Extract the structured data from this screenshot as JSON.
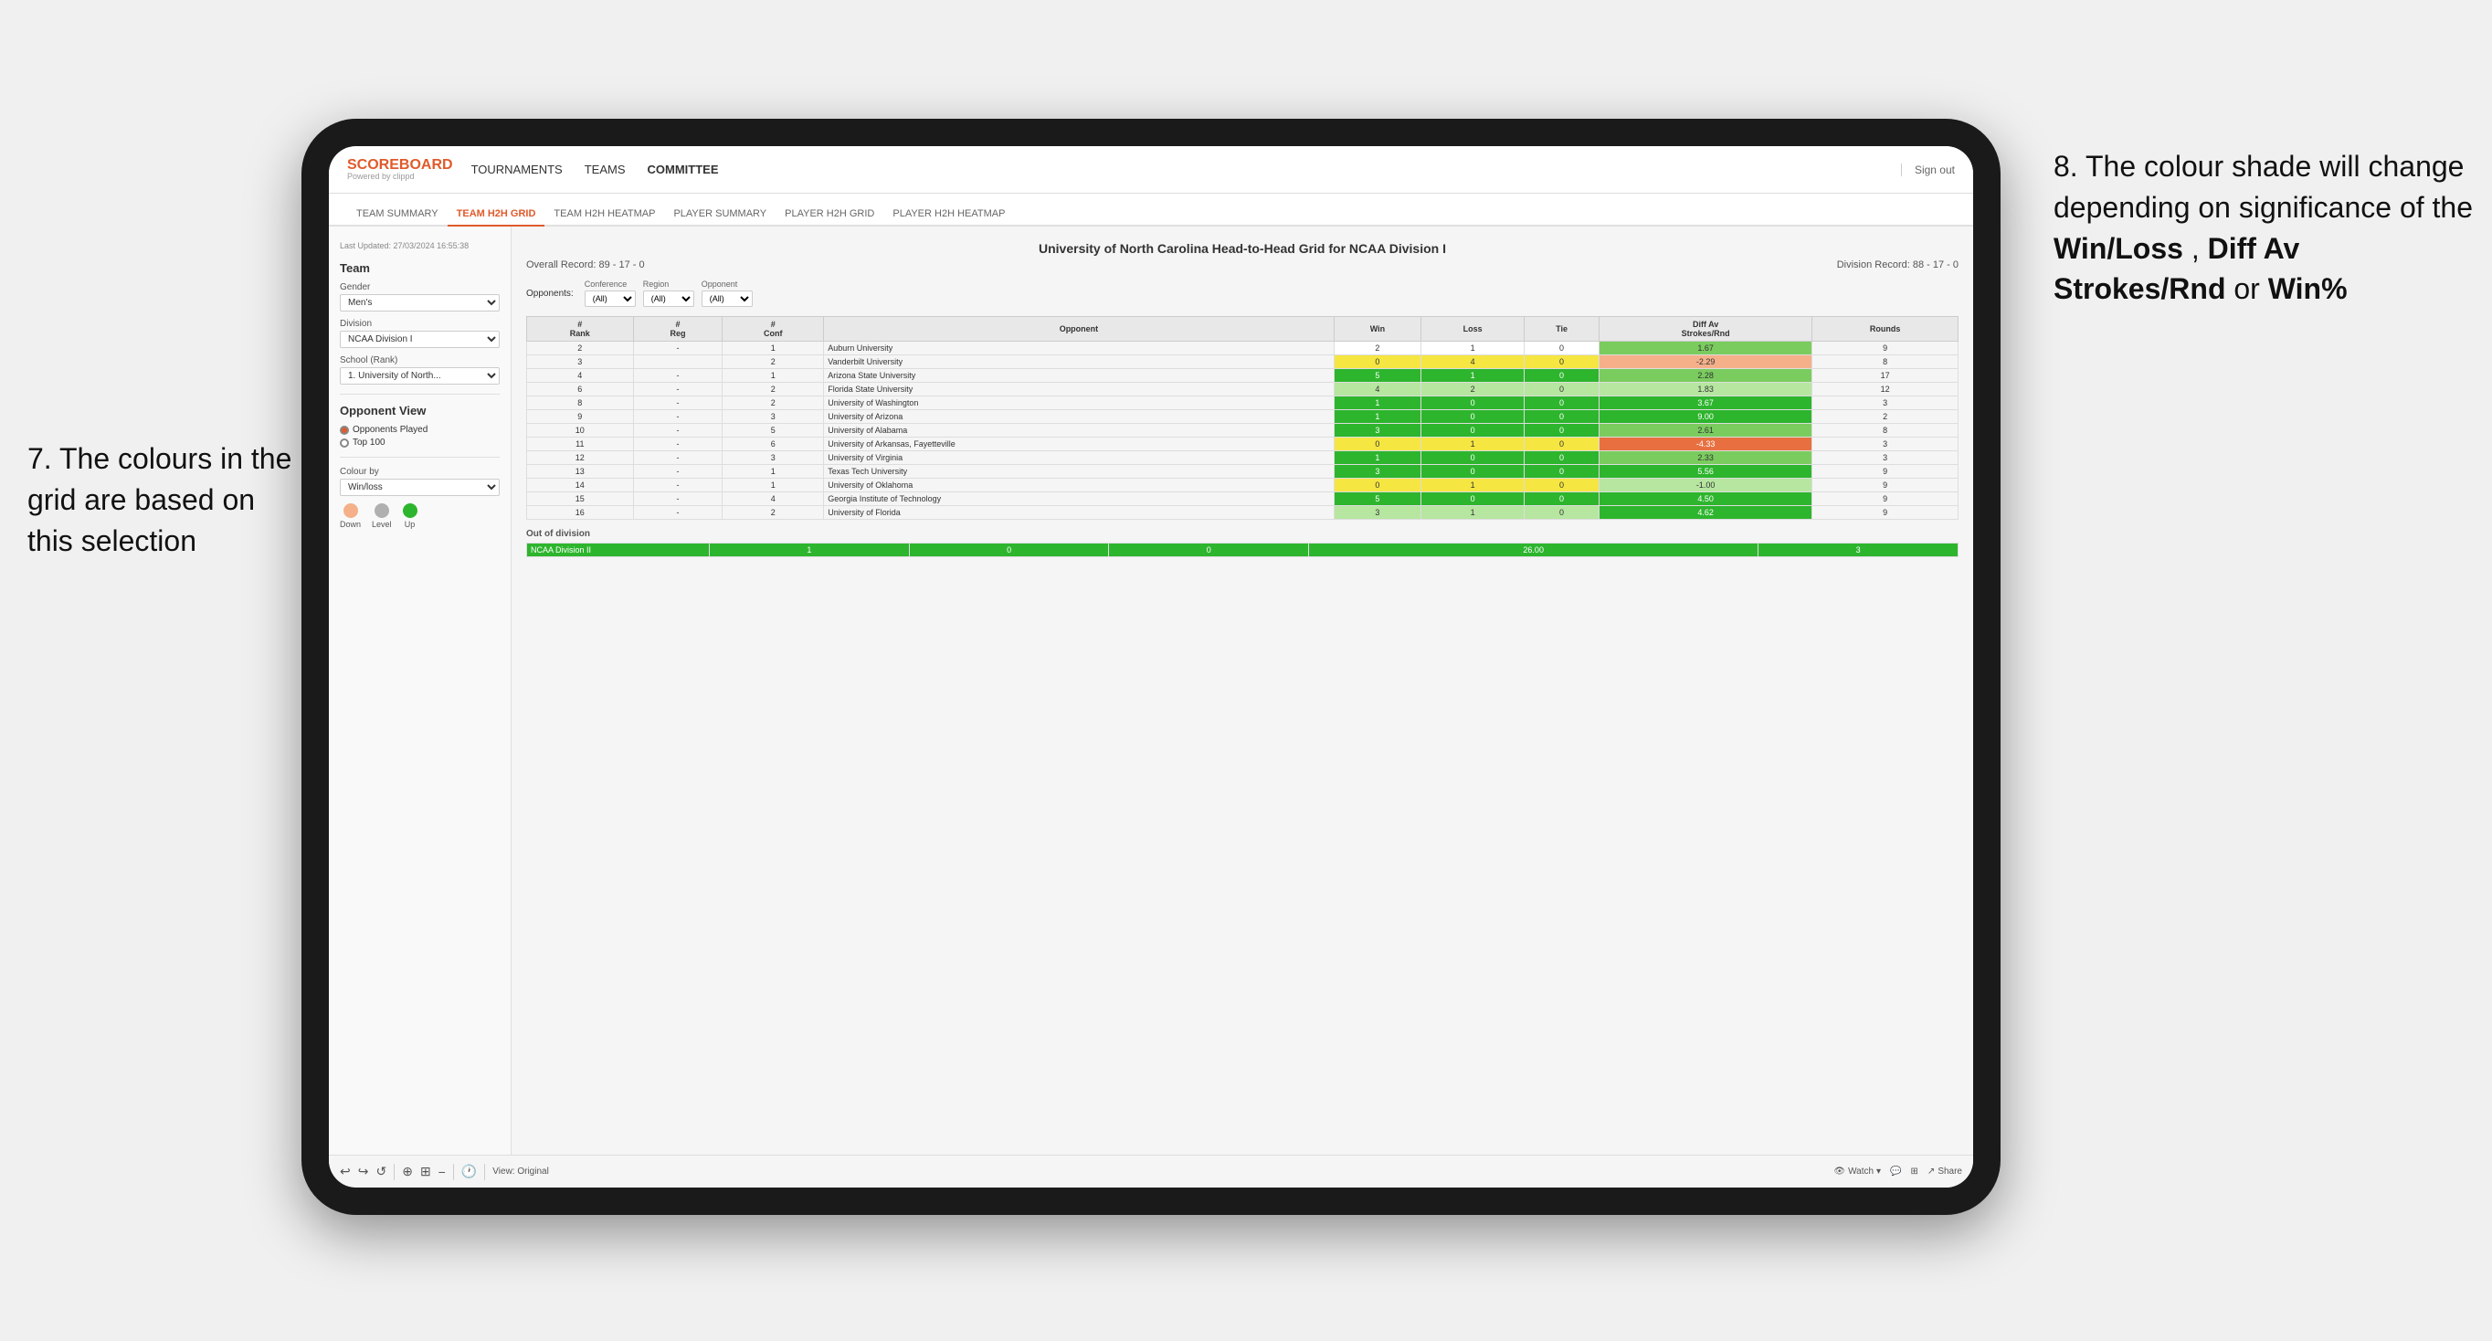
{
  "annotations": {
    "left_title": "7. The colours in the grid are based on this selection",
    "right_title": "8. The colour shade will change depending on significance of the",
    "right_bold1": "Win/Loss",
    "right_bold2": "Diff Av Strokes/Rnd",
    "right_bold3": "Win%",
    "right_connector": " or "
  },
  "nav": {
    "logo": "SCOREBOARD",
    "logo_sub": "Powered by clippd",
    "links": [
      "TOURNAMENTS",
      "TEAMS",
      "COMMITTEE"
    ],
    "active_link": "COMMITTEE",
    "sign_out": "Sign out"
  },
  "sub_nav": {
    "items": [
      "TEAM SUMMARY",
      "TEAM H2H GRID",
      "TEAM H2H HEATMAP",
      "PLAYER SUMMARY",
      "PLAYER H2H GRID",
      "PLAYER H2H HEATMAP"
    ],
    "active": "TEAM H2H GRID"
  },
  "sidebar": {
    "timestamp": "Last Updated: 27/03/2024\n16:55:38",
    "section_title": "Team",
    "gender_label": "Gender",
    "gender_value": "Men's",
    "division_label": "Division",
    "division_value": "NCAA Division I",
    "school_label": "School (Rank)",
    "school_value": "1. University of North...",
    "opponent_view_label": "Opponent View",
    "radio_opponents": "Opponents Played",
    "radio_top100": "Top 100",
    "colour_by_label": "Colour by",
    "colour_by_value": "Win/loss",
    "legend_down": "Down",
    "legend_level": "Level",
    "legend_up": "Up"
  },
  "grid": {
    "title": "University of North Carolina Head-to-Head Grid for NCAA Division I",
    "overall_record": "Overall Record: 89 - 17 - 0",
    "division_record": "Division Record: 88 - 17 - 0",
    "filters": {
      "opponents_label": "Opponents:",
      "conference_label": "Conference",
      "conference_value": "(All)",
      "region_label": "Region",
      "region_value": "(All)",
      "opponent_label": "Opponent",
      "opponent_value": "(All)"
    },
    "columns": [
      "#\nRank",
      "#\nReg",
      "#\nConf",
      "Opponent",
      "Win",
      "Loss",
      "Tie",
      "Diff Av\nStrokes/Rnd",
      "Rounds"
    ],
    "rows": [
      {
        "rank": "2",
        "reg": "-",
        "conf": "1",
        "opponent": "Auburn University",
        "win": "2",
        "loss": "1",
        "tie": "0",
        "diff": "1.67",
        "rounds": "9",
        "win_color": "white",
        "diff_color": "green_mid"
      },
      {
        "rank": "3",
        "reg": "",
        "conf": "2",
        "opponent": "Vanderbilt University",
        "win": "0",
        "loss": "4",
        "tie": "0",
        "diff": "-2.29",
        "rounds": "8",
        "win_color": "yellow",
        "diff_color": "red_light"
      },
      {
        "rank": "4",
        "reg": "-",
        "conf": "1",
        "opponent": "Arizona State University",
        "win": "5",
        "loss": "1",
        "tie": "0",
        "diff": "2.28",
        "rounds": "17",
        "win_color": "green_strong",
        "diff_color": "green_mid"
      },
      {
        "rank": "6",
        "reg": "-",
        "conf": "2",
        "opponent": "Florida State University",
        "win": "4",
        "loss": "2",
        "tie": "0",
        "diff": "1.83",
        "rounds": "12",
        "win_color": "green_light",
        "diff_color": "green_light"
      },
      {
        "rank": "8",
        "reg": "-",
        "conf": "2",
        "opponent": "University of Washington",
        "win": "1",
        "loss": "0",
        "tie": "0",
        "diff": "3.67",
        "rounds": "3",
        "win_color": "green_strong",
        "diff_color": "green_strong"
      },
      {
        "rank": "9",
        "reg": "-",
        "conf": "3",
        "opponent": "University of Arizona",
        "win": "1",
        "loss": "0",
        "tie": "0",
        "diff": "9.00",
        "rounds": "2",
        "win_color": "green_strong",
        "diff_color": "green_strong"
      },
      {
        "rank": "10",
        "reg": "-",
        "conf": "5",
        "opponent": "University of Alabama",
        "win": "3",
        "loss": "0",
        "tie": "0",
        "diff": "2.61",
        "rounds": "8",
        "win_color": "green_strong",
        "diff_color": "green_mid"
      },
      {
        "rank": "11",
        "reg": "-",
        "conf": "6",
        "opponent": "University of Arkansas, Fayetteville",
        "win": "0",
        "loss": "1",
        "tie": "0",
        "diff": "-4.33",
        "rounds": "3",
        "win_color": "yellow",
        "diff_color": "red_mid"
      },
      {
        "rank": "12",
        "reg": "-",
        "conf": "3",
        "opponent": "University of Virginia",
        "win": "1",
        "loss": "0",
        "tie": "0",
        "diff": "2.33",
        "rounds": "3",
        "win_color": "green_strong",
        "diff_color": "green_mid"
      },
      {
        "rank": "13",
        "reg": "-",
        "conf": "1",
        "opponent": "Texas Tech University",
        "win": "3",
        "loss": "0",
        "tie": "0",
        "diff": "5.56",
        "rounds": "9",
        "win_color": "green_strong",
        "diff_color": "green_strong"
      },
      {
        "rank": "14",
        "reg": "-",
        "conf": "1",
        "opponent": "University of Oklahoma",
        "win": "0",
        "loss": "1",
        "tie": "0",
        "diff": "-1.00",
        "rounds": "9",
        "win_color": "yellow",
        "diff_color": "green_light"
      },
      {
        "rank": "15",
        "reg": "-",
        "conf": "4",
        "opponent": "Georgia Institute of Technology",
        "win": "5",
        "loss": "0",
        "tie": "0",
        "diff": "4.50",
        "rounds": "9",
        "win_color": "green_strong",
        "diff_color": "green_strong"
      },
      {
        "rank": "16",
        "reg": "-",
        "conf": "2",
        "opponent": "University of Florida",
        "win": "3",
        "loss": "1",
        "tie": "0",
        "diff": "4.62",
        "rounds": "9",
        "win_color": "green_light",
        "diff_color": "green_strong"
      }
    ],
    "out_of_division_label": "Out of division",
    "out_of_division_row": {
      "name": "NCAA Division II",
      "win": "1",
      "loss": "0",
      "tie": "0",
      "diff": "26.00",
      "rounds": "3",
      "color": "green_strong"
    }
  },
  "toolbar": {
    "view_label": "View: Original",
    "watch_label": "Watch",
    "share_label": "Share"
  }
}
